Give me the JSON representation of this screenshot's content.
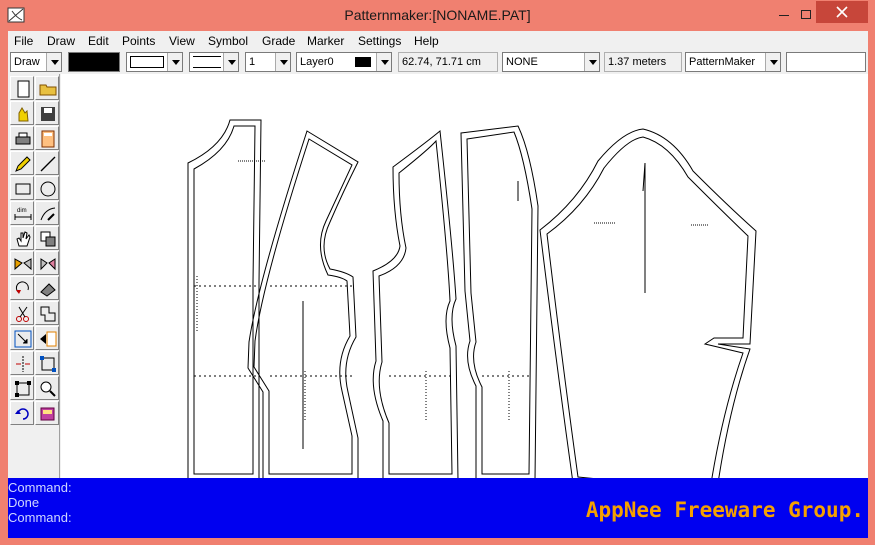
{
  "window": {
    "title": "Patternmaker:[NONAME.PAT]"
  },
  "menu": [
    "File",
    "Draw",
    "Edit",
    "Points",
    "View",
    "Symbol",
    "Grade",
    "Marker",
    "Settings",
    "Help"
  ],
  "toolbar": {
    "mode_select": "Draw",
    "line_weight": "1",
    "layer_select": "Layer0",
    "coordinates": "62.74, 71.71 cm",
    "grade_select": "NONE",
    "length_readout": "1.37 meters",
    "mode_name_select": "PatternMaker",
    "command_input": ""
  },
  "colors": {
    "fill_color": "#000000",
    "layer_color": "#000000",
    "command_bg": "#0000f0",
    "watermark": "#f5a000"
  },
  "tools": [
    [
      "new-file-icon",
      "open-folder-icon"
    ],
    [
      "hand-select-icon",
      "save-disk-icon"
    ],
    [
      "printer-icon",
      "calculator-icon"
    ],
    [
      "pencil-icon",
      "line-icon"
    ],
    [
      "rectangle-icon",
      "circle-icon"
    ],
    [
      "dimension-icon",
      "curve-pen-icon"
    ],
    [
      "pan-hand-icon",
      "copy-shapes-icon"
    ],
    [
      "mirror-icon",
      "rotate-mirror-icon"
    ],
    [
      "rotate-icon",
      "eraser-icon"
    ],
    [
      "scissors-icon",
      "overlap-icon"
    ],
    [
      "scale-icon",
      "move-arrow-icon"
    ],
    [
      "split-point-icon",
      "resize-handles-icon"
    ],
    [
      "transform-icon",
      "zoom-icon"
    ],
    [
      "undo-icon",
      "book-icon"
    ]
  ],
  "command_lines": [
    "Command:",
    "Done",
    "Command:"
  ],
  "watermark_text": "AppNee Freeware Group."
}
